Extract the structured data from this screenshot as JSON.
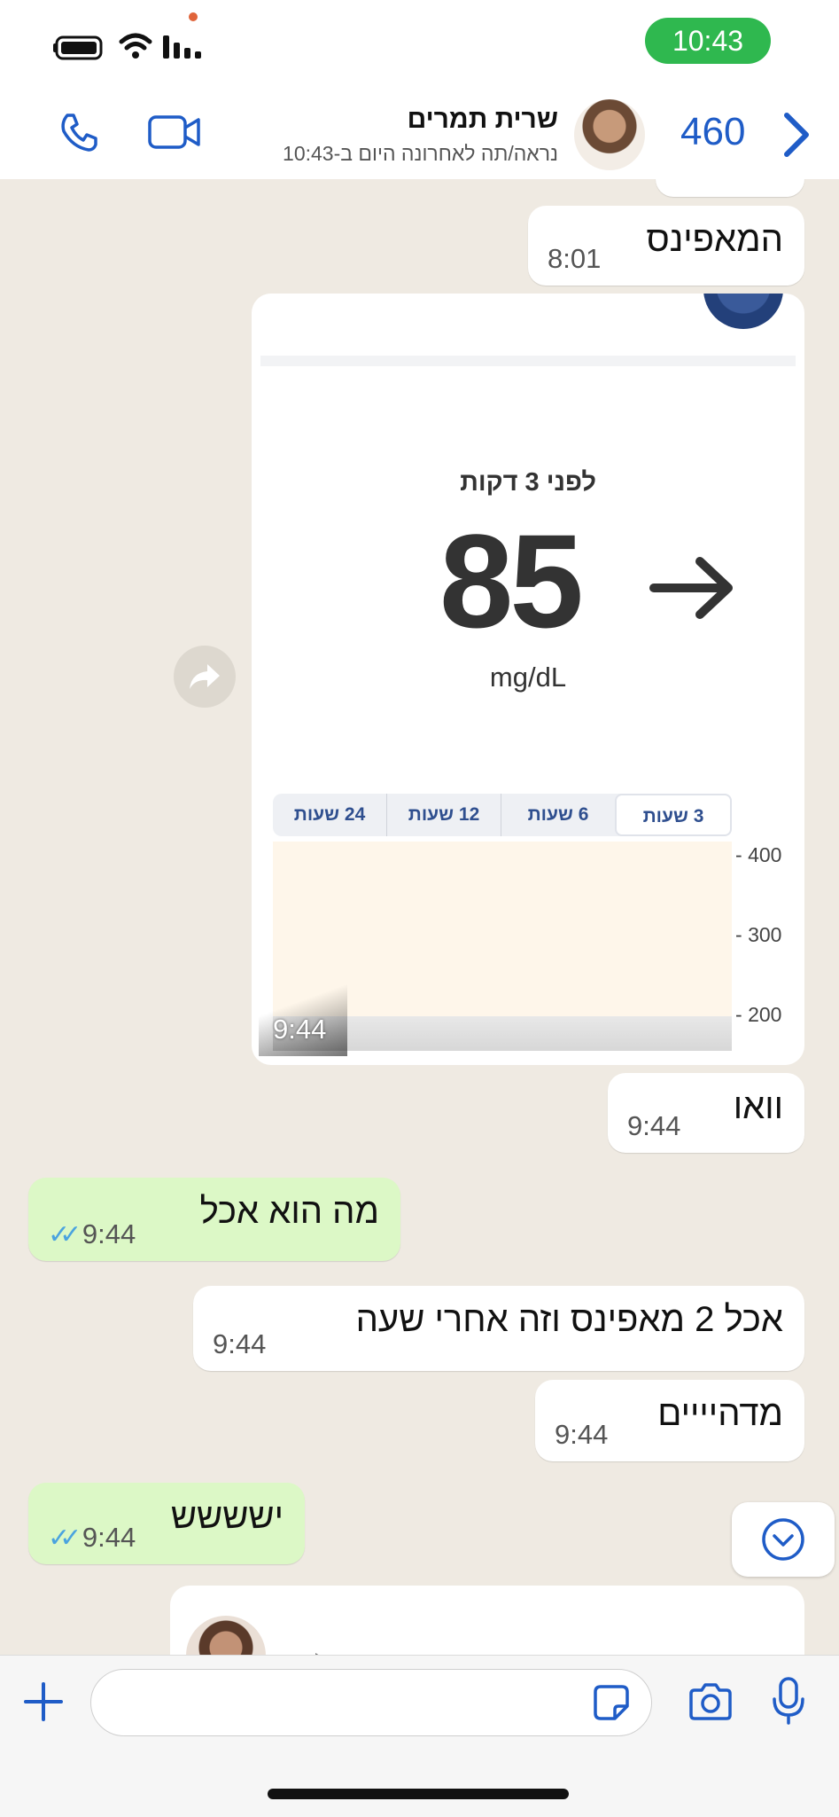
{
  "status_bar": {
    "time": "10:43"
  },
  "header": {
    "contact_name": "שרית תמרים",
    "last_seen": "נראה/תה לאחרונה היום ב-10:43",
    "unread_count": "460"
  },
  "messages": [
    {
      "direction": "in",
      "text": "המאפינס",
      "time": "8:01"
    },
    {
      "direction": "in",
      "type": "image",
      "time": "9:44"
    },
    {
      "direction": "in",
      "text": "וואו",
      "time": "9:44"
    },
    {
      "direction": "out",
      "text": "מה הוא אכל",
      "time": "9:44",
      "status": "read"
    },
    {
      "direction": "in",
      "text": "אכל 2 מאפינס וזה אחרי שעה",
      "time": "9:44"
    },
    {
      "direction": "in",
      "text": "מדהיייים",
      "time": "9:44"
    },
    {
      "direction": "out",
      "text": "ישששש",
      "time": "9:44",
      "status": "read"
    }
  ],
  "glucose_card": {
    "minutes_ago": "לפני 3 דקות",
    "value": "85",
    "unit": "mg/dL",
    "trend": "arrow-right",
    "range_tabs": [
      "3 שעות",
      "6 שעות",
      "12 שעות",
      "24 שעות"
    ],
    "active_tab": "3 שעות",
    "y_ticks": [
      "400",
      "300",
      "200"
    ]
  },
  "colors": {
    "incoming_bubble": "#ffffff",
    "outgoing_bubble": "#dcf8c6",
    "chat_background": "#efeae2",
    "accent": "#1f5cc7",
    "read_ticks": "#4aa3df",
    "status_time_pill": "#2fb84f"
  }
}
